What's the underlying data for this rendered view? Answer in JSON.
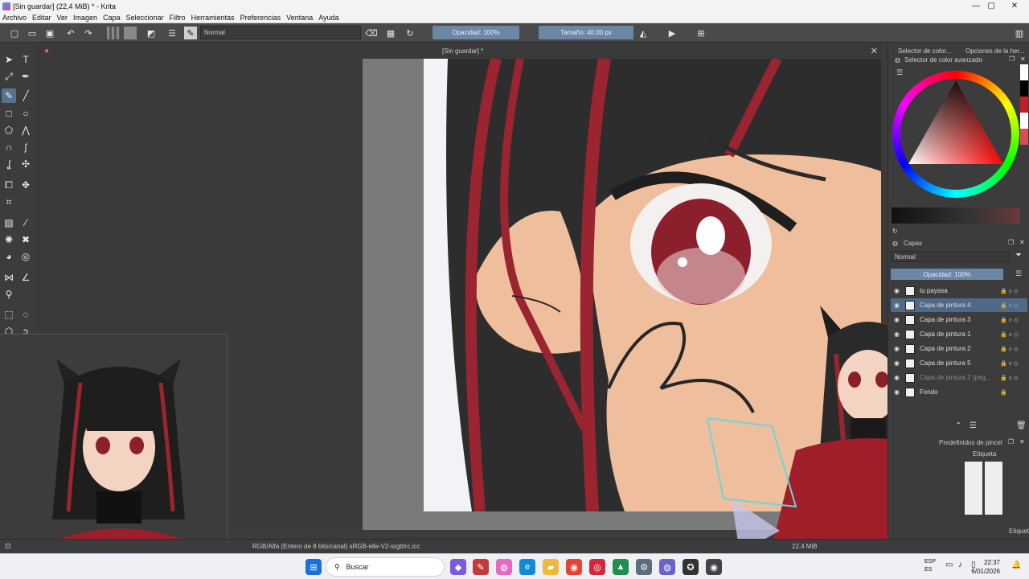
{
  "window": {
    "title": "[Sin guardar]  (22,4 MiB)  * - Krita"
  },
  "menu": [
    "Archivo",
    "Editar",
    "Ver",
    "Imagen",
    "Capa",
    "Seleccionar",
    "Filtro",
    "Herramientas",
    "Preferencias",
    "Ventana",
    "Ayuda"
  ],
  "toolbar": {
    "blend_mode": "Normal",
    "opacity_label": "Opacidad: 100%",
    "size_label": "Tamaño: 40,00 px"
  },
  "document": {
    "tab_title": "[Sin guardar]  *"
  },
  "right_dock": {
    "tabs": [
      "Selector de color...",
      "Opciones de la her..."
    ],
    "color_panel_title": "Selector de color avanzado",
    "layers_panel_title": "Capas",
    "layers_blend": "Normal",
    "layers_opacity": "Opacidad: 100%",
    "layers": [
      {
        "name": "tu payasa",
        "selected": false
      },
      {
        "name": "Capa de pintura 4",
        "selected": true
      },
      {
        "name": "Capa de pintura 3",
        "selected": false
      },
      {
        "name": "Capa de pintura 1",
        "selected": false
      },
      {
        "name": "Capa de pintura 2",
        "selected": false
      },
      {
        "name": "Capa de pintura 5",
        "selected": false
      },
      {
        "name": "Capa de pintura 2 (peg...",
        "selected": false
      },
      {
        "name": "Fondo",
        "selected": false
      }
    ],
    "brush_panel_title": "Predefinidos de pincel",
    "brush_tag": "Etiqueta",
    "brush_footer": "Etiqueta"
  },
  "status": {
    "color_space": "RGB/Alfa (Entero de 8 bits/canal)  sRGB-elle-V2-srgbtrc.icc",
    "memory": "22,4 MiB"
  },
  "taskbar": {
    "search_placeholder": "Buscar",
    "lang": "ESP",
    "lang2": "ES",
    "time": "22:37",
    "date": "6/01/2026"
  },
  "colors": {
    "accent": "#6b87a6",
    "hair_red": "#9a2430",
    "hair_dark": "#2d2d2d",
    "skin": "#efbf9d",
    "eye": "#8c1f2c"
  }
}
